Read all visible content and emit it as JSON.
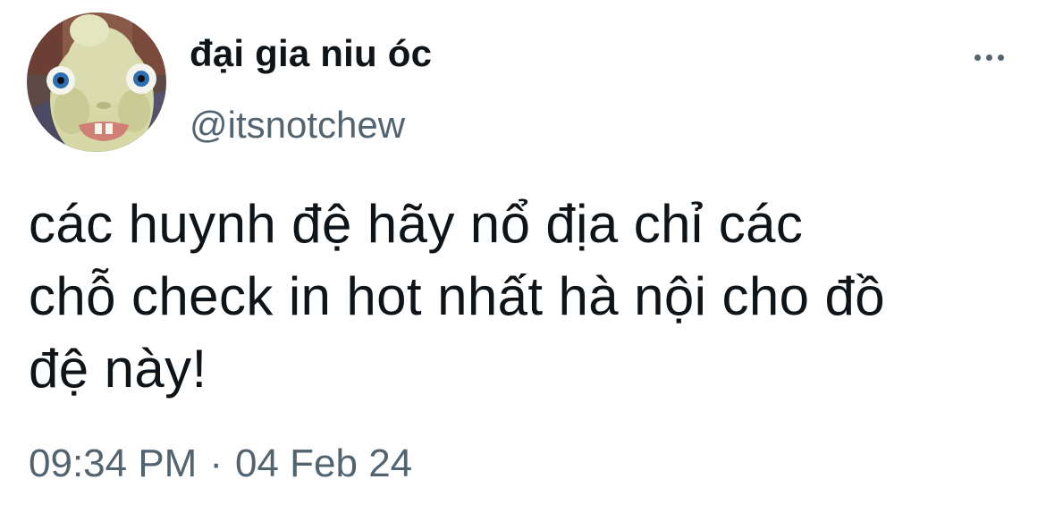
{
  "author": {
    "display_name": "đại gia niu óc",
    "handle": "@itsnotchew",
    "avatar_icon": "rabbid-character-avatar"
  },
  "menu": {
    "icon": "more-options-icon"
  },
  "tweet": {
    "text_lines": [
      "các huynh đệ hãy nổ địa chỉ các",
      "chỗ check in hot nhất hà nội cho đồ",
      "đệ này!"
    ]
  },
  "meta": {
    "time": "09:34 PM",
    "separator": "·",
    "date": "04 Feb 24"
  },
  "colors": {
    "text_primary": "#0f1419",
    "text_secondary": "#536471",
    "background": "#ffffff"
  }
}
